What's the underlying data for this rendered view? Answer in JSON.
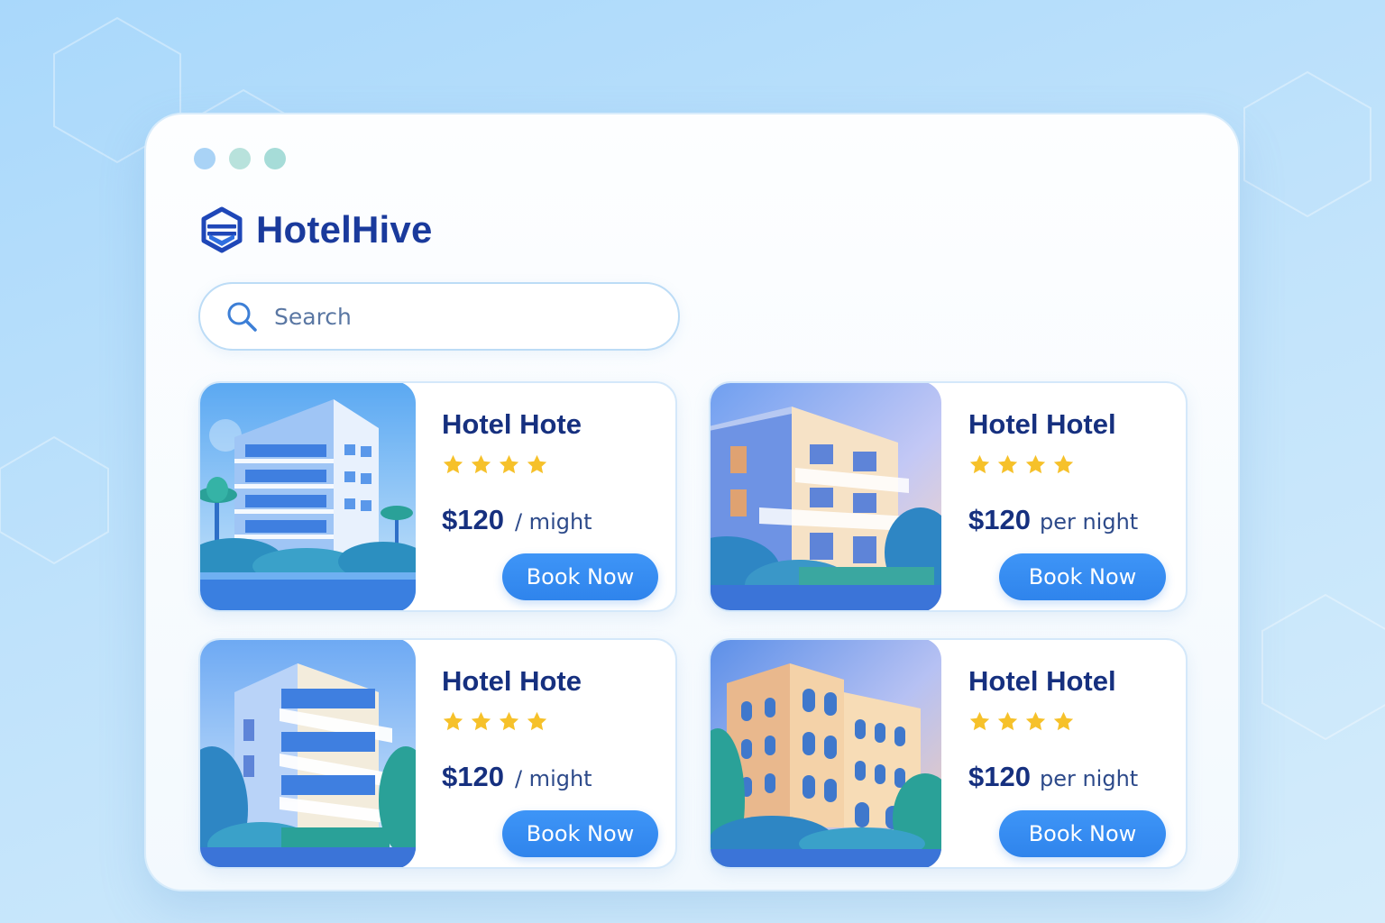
{
  "window": {
    "traffic_lights": [
      "#a9d3f6",
      "#b8e2dc",
      "#a6dcd8"
    ]
  },
  "brand": {
    "name": "HotelHive",
    "logo_icon": "hexagon-logo-icon",
    "color": "#1a3a9c"
  },
  "search": {
    "placeholder": "Search",
    "value": "",
    "icon": "search-icon"
  },
  "hotels": [
    {
      "title": "Hotel Hote",
      "stars": 4,
      "price": "$120",
      "unit": "/ might",
      "button": "Book Now"
    },
    {
      "title": "Hotel Hotel",
      "stars": 4,
      "price": "$120",
      "unit": "per night",
      "button": "Book Now"
    },
    {
      "title": "Hotel Hote",
      "stars": 4,
      "price": "$120",
      "unit": "/ might",
      "button": "Book Now"
    },
    {
      "title": "Hotel Hotel",
      "stars": 4,
      "price": "$120",
      "unit": "per night",
      "button": "Book Now"
    }
  ],
  "colors": {
    "accent": "#2f84ec",
    "star": "#f6c12a",
    "text_dark": "#16307f"
  }
}
